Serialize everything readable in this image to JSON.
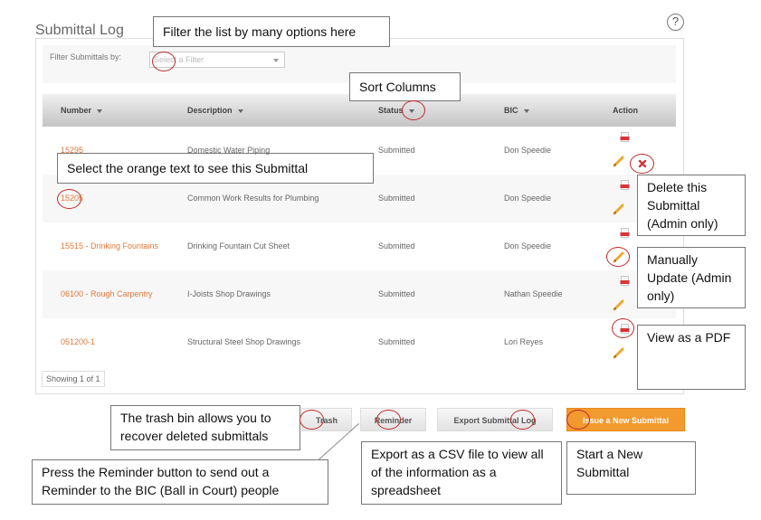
{
  "page": {
    "title": "Submittal Log",
    "help_icon": "question-circle-icon"
  },
  "filter": {
    "label": "Filter Submittals by:",
    "placeholder": "Select a Filter"
  },
  "table": {
    "columns": [
      {
        "label": "Number",
        "sortable": true
      },
      {
        "label": "Description",
        "sortable": true
      },
      {
        "label": "Status",
        "sortable": true
      },
      {
        "label": "BIC",
        "sortable": true
      },
      {
        "label": "Action",
        "sortable": false
      }
    ],
    "rows": [
      {
        "number": "15295",
        "description": "Domestic Water Piping",
        "status": "Submitted",
        "bic": "Don Speedie",
        "actions": [
          "pdf-icon",
          "pencil-icon",
          "delete-icon"
        ]
      },
      {
        "number": "15205",
        "description": "Common Work Results for Plumbing",
        "status": "Submitted",
        "bic": "Don Speedie",
        "actions": [
          "pdf-icon",
          "pencil-icon"
        ]
      },
      {
        "number": "15515 - Drinking Fountains",
        "description": "Drinking Fountain Cut Sheet",
        "status": "Submitted",
        "bic": "Don Speedie",
        "actions": [
          "pdf-icon",
          "pencil-icon"
        ]
      },
      {
        "number": "06100 - Rough Carpentry",
        "description": "I-Joists Shop Drawings",
        "status": "Submitted",
        "bic": "Nathan Speedie",
        "actions": [
          "pdf-icon",
          "pencil-icon"
        ]
      },
      {
        "number": "051200-1",
        "description": "Structural Steel Shop Drawings",
        "status": "Submitted",
        "bic": "Lori Reyes",
        "actions": [
          "pdf-icon",
          "pencil-icon"
        ]
      }
    ],
    "pagination": "Showing 1 of 1"
  },
  "buttons": {
    "trash": "Trash",
    "reminder": "Reminder",
    "export": "Export Submittal Log",
    "new": "Issue a New Submittal"
  },
  "callouts": {
    "filter": "Filter the list by many options here",
    "sort": "Sort Columns",
    "select": "Select the orange text to see this Submittal",
    "delete": "Delete this Submittal (Admin only)",
    "update": "Manually Update (Admin only)",
    "pdf": "View as a PDF",
    "trash": "The trash bin allows you to recover deleted submittals",
    "reminder": "Press the Reminder button to send out a Reminder to the BIC (Ball in Court) people",
    "export": "Export as a CSV file to view all of the information as a spreadsheet",
    "new": "Start a New Submittal"
  },
  "colors": {
    "link_orange": "#e0793a",
    "primary_button": "#f29a2e",
    "marker_red": "#c0282a",
    "delete_red": "#d9333a"
  }
}
